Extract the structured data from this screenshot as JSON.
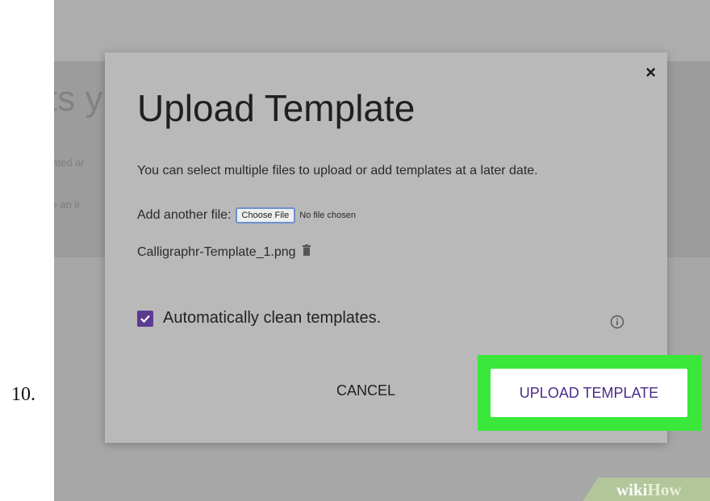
{
  "step_number": "10.",
  "background": {
    "heading_fragment": "ts y",
    "line1_fragment": "eated ar",
    "line2_fragment": "ve an ir"
  },
  "modal": {
    "close_symbol": "×",
    "title": "Upload Template",
    "description": "You can select multiple files to upload or add templates at a later date.",
    "add_file_label": "Add another file:",
    "choose_file_button": "Choose File",
    "no_file_text": "No file chosen",
    "uploaded_file_name": "Calligraphr-Template_1.png",
    "auto_clean": {
      "label": "Automatically clean templates.",
      "checked": true
    },
    "cancel_label": "CANCEL",
    "upload_label": "UPLOAD TEMPLATE"
  },
  "watermark": {
    "wiki": "wiki",
    "how": "How"
  },
  "colors": {
    "accent_purple": "#5b3a91",
    "highlight_green": "#39e83a",
    "overlay_gray": "#a7a7a7"
  },
  "icons": [
    "close-icon",
    "trash-icon",
    "checkbox-checked-icon",
    "info-icon"
  ]
}
